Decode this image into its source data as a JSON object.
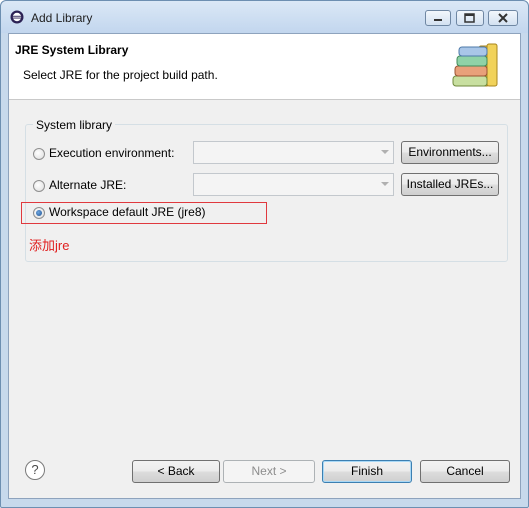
{
  "window": {
    "title": "Add Library"
  },
  "banner": {
    "title": "JRE System Library",
    "description": "Select JRE for the project build path."
  },
  "group": {
    "label": "System library",
    "options": [
      {
        "label": "Execution environment:",
        "checked": false,
        "combo_value": "",
        "button": "Environments..."
      },
      {
        "label": "Alternate JRE:",
        "checked": false,
        "combo_value": "",
        "button": "Installed JREs..."
      },
      {
        "label": "Workspace default JRE (jre8)",
        "checked": true
      }
    ]
  },
  "annotation": {
    "text": "添加jre",
    "color": "#e02020"
  },
  "buttons": {
    "back": "< Back",
    "next": "Next >",
    "finish": "Finish",
    "cancel": "Cancel"
  },
  "help_icon": "question-mark",
  "colors": {
    "highlight": "#e0393e",
    "title_bar": "#c2d6ee"
  }
}
